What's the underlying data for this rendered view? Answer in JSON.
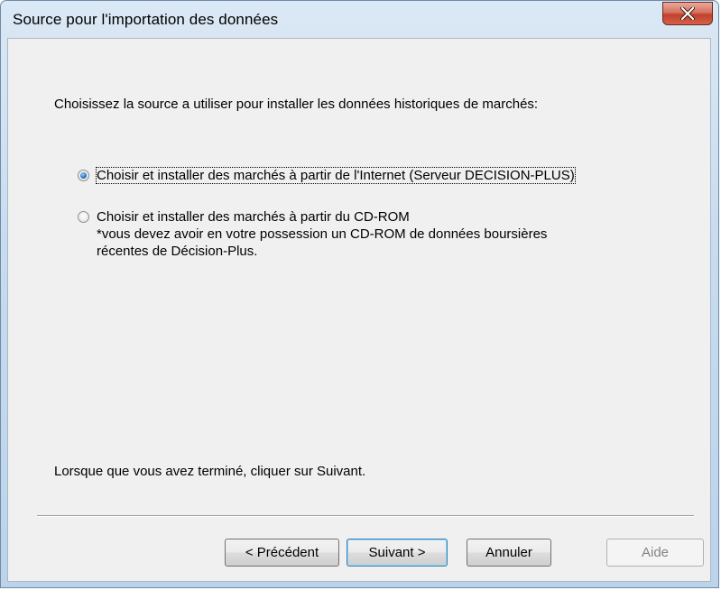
{
  "window": {
    "title": "Source pour l'importation des données"
  },
  "content": {
    "instruction": "Choisissez la source a utiliser pour installer les données historiques de marchés:",
    "options": [
      {
        "label": "Choisir et installer des marchés à partir de l'Internet (Serveur DECISION-PLUS)",
        "selected": true
      },
      {
        "label": "Choisir et installer des marchés à partir du CD-ROM",
        "note_line1": "*vous devez avoir en votre possession un CD-ROM de données boursières",
        "note_line2": "récentes de Décision-Plus.",
        "selected": false
      }
    ],
    "finish_text": "Lorsque que vous avez terminé, cliquer sur Suivant."
  },
  "buttons": {
    "previous": "< Précédent",
    "next": "Suivant >",
    "cancel": "Annuler",
    "help": "Aide"
  },
  "colors": {
    "close_button": "#c1412b",
    "client_background": "#f0f0f0",
    "frame": "#bcd3ea"
  }
}
